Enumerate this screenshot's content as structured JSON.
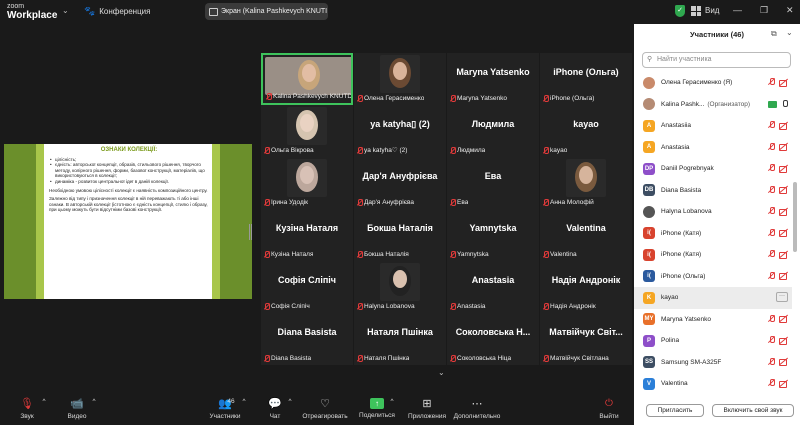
{
  "topbar": {
    "logo_small": "zoom",
    "logo_large": "Workplace",
    "meeting_label": "Конференция",
    "screen_share_label": "Экран (Kalina Pashkevych KNUTI",
    "view_label": "Вид"
  },
  "slide": {
    "title": "ОЗНАКИ КОЛЕКЦІЇ:",
    "bullets": [
      "цілісність;",
      "єдність: авторської концепції, образів, стильового рішення, творчого методу, колірного рішення, форми, базової конструкції, матеріалів, що використовуються в колекції;",
      "динаміка - розвиток центральної ідеї в даній колекції."
    ],
    "para1": "Необхідною умовою цілісності колекції є наявність композиційного центру.",
    "para2": "Залежно від типу і призначення колекції в ній переважають ті або інші ознаки. В авторській колекції (істотною є єдність концепції, стилю і образу, при цьому можуть бути відсутніми базові конструкції."
  },
  "gallery": {
    "tiles": [
      {
        "name": "",
        "label": "Kalina Pashkevych KNUTD U..."
      },
      {
        "name": "",
        "label": "Олена Герасименко"
      },
      {
        "name": "Maryna Yatsenko",
        "label": "Maryna Yatsenko"
      },
      {
        "name": "iPhone (Ольга)",
        "label": "iPhone (Ольга)"
      },
      {
        "name": "",
        "label": "Ольга Вікрова"
      },
      {
        "name": "ya katyha▯ (2)",
        "label": "ya katyha♡ (2)"
      },
      {
        "name": "Людмила",
        "label": "Людмила"
      },
      {
        "name": "kayao",
        "label": "kayao"
      },
      {
        "name": "",
        "label": "Ірина Удодік"
      },
      {
        "name": "Дар'я Ануфрієва",
        "label": "Дар'я Ануфрієва"
      },
      {
        "name": "Ева",
        "label": "Ева"
      },
      {
        "name": "",
        "label": "Анна Молофій"
      },
      {
        "name": "Кузіна Наталя",
        "label": "Кузіна Наталя"
      },
      {
        "name": "Бокша Наталія",
        "label": "Бокша Наталія"
      },
      {
        "name": "Yamnytska",
        "label": "Yamnytska"
      },
      {
        "name": "Valentina",
        "label": "Valentina"
      },
      {
        "name": "Софія Сліпіч",
        "label": "Софія Сліпіч"
      },
      {
        "name": "",
        "label": "Halyna Lobanova"
      },
      {
        "name": "Anastasia",
        "label": "Anastasia"
      },
      {
        "name": "Надія Андронік",
        "label": "Надія Андронік"
      },
      {
        "name": "Diana Basista",
        "label": "Diana Basista"
      },
      {
        "name": "Наталя Пшінка",
        "label": "Наталя Пшінка"
      },
      {
        "name": "Соколовська Н...",
        "label": "Соколовська Ніца"
      },
      {
        "name": "Матвійчук Світ...",
        "label": "Матвійчук Світлана"
      }
    ]
  },
  "toolbar": {
    "audio": "Звук",
    "video": "Видео",
    "participants": "Участники",
    "participants_count": "46",
    "chat": "Чат",
    "react": "Отреагировать",
    "share": "Поделиться",
    "apps": "Приложения",
    "more": "Дополнительно",
    "leave": "Выйти"
  },
  "panel": {
    "title": "Участники (46)",
    "search_placeholder": "Найти участника",
    "participants": [
      {
        "initials": "",
        "name": "Олена Герасименко (Я)",
        "color": "#c98a6a"
      },
      {
        "initials": "",
        "name": "Kalina Pashk...",
        "role": "(Организатор)",
        "color": "#b58b74"
      },
      {
        "initials": "A",
        "name": "Anastasiia",
        "color": "#f5a623"
      },
      {
        "initials": "A",
        "name": "Anastasia",
        "color": "#f5a623"
      },
      {
        "initials": "DP",
        "name": "Daniil Pogrebnyak",
        "color": "#8e4fc9"
      },
      {
        "initials": "DB",
        "name": "Diana Basista",
        "color": "#3d4e63"
      },
      {
        "initials": "",
        "name": "Halyna Lobanova",
        "color": "#555555"
      },
      {
        "initials": "i(",
        "name": "iPhone (Катя)",
        "color": "#d8432e"
      },
      {
        "initials": "i(",
        "name": "iPhone (Катя)",
        "color": "#d8432e"
      },
      {
        "initials": "i(",
        "name": "iPhone (Ольга)",
        "color": "#2b5a9e"
      },
      {
        "initials": "K",
        "name": "kayao",
        "color": "#f5a623"
      },
      {
        "initials": "MY",
        "name": "Maryna Yatsenko",
        "color": "#e8702a"
      },
      {
        "initials": "P",
        "name": "Polina",
        "color": "#8e4fc9"
      },
      {
        "initials": "SS",
        "name": "Samsung SM-A325F",
        "color": "#3d4e63"
      },
      {
        "initials": "V",
        "name": "Valentina",
        "color": "#2b7fd8"
      }
    ],
    "invite_label": "Пригласить",
    "unmute_label": "Включить свой звук"
  }
}
